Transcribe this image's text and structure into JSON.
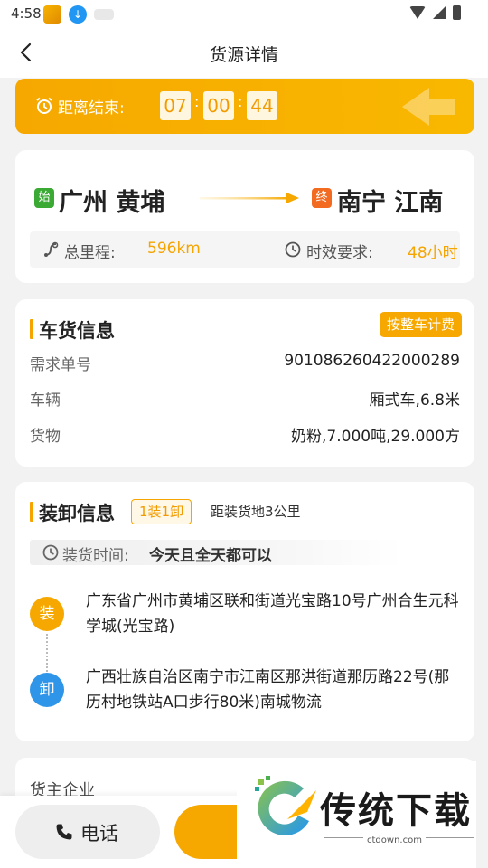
{
  "status_bar": {
    "time": "4:58"
  },
  "nav": {
    "title": "货源详情"
  },
  "countdown": {
    "label": "距离结束:",
    "hours": "07",
    "minutes": "00",
    "seconds": "44"
  },
  "route": {
    "start_tag": "始",
    "from": "广州 黄埔",
    "end_tag": "终",
    "to": "南宁 江南",
    "distance_label": "总里程:",
    "distance_value": "596km",
    "time_label": "时效要求:",
    "time_value": "48小时"
  },
  "goods_info": {
    "title": "车货信息",
    "pricing_button": "按整车计费",
    "rows": [
      {
        "key": "需求单号",
        "value": "901086260422000289"
      },
      {
        "key": "车辆",
        "value": "厢式车,6.8米"
      },
      {
        "key": "货物",
        "value": "奶粉,7.000吨,29.000方"
      }
    ]
  },
  "load_info": {
    "title": "装卸信息",
    "badge": "1装1卸",
    "distance_note": "距装货地3公里",
    "load_time_label": "装货时间:",
    "load_time_value": "今天且全天都可以",
    "load_tag": "装",
    "load_address": "广东省广州市黄埔区联和街道光宝路10号广州合生元科学城(光宝路)",
    "unload_tag": "卸",
    "unload_address": "广西壮族自治区南宁市江南区那洪街道那历路22号(那历村地铁站A口步行80米)南城物流"
  },
  "owner": {
    "title": "货主企业"
  },
  "bottom": {
    "call_label": "电话"
  },
  "watermark": {
    "text": "传统下载",
    "url": "ctdown.com"
  },
  "colors": {
    "accent": "#f6a800",
    "start_green": "#3aaa35",
    "end_orange": "#f26b21",
    "unload_blue": "#2f95e8"
  }
}
